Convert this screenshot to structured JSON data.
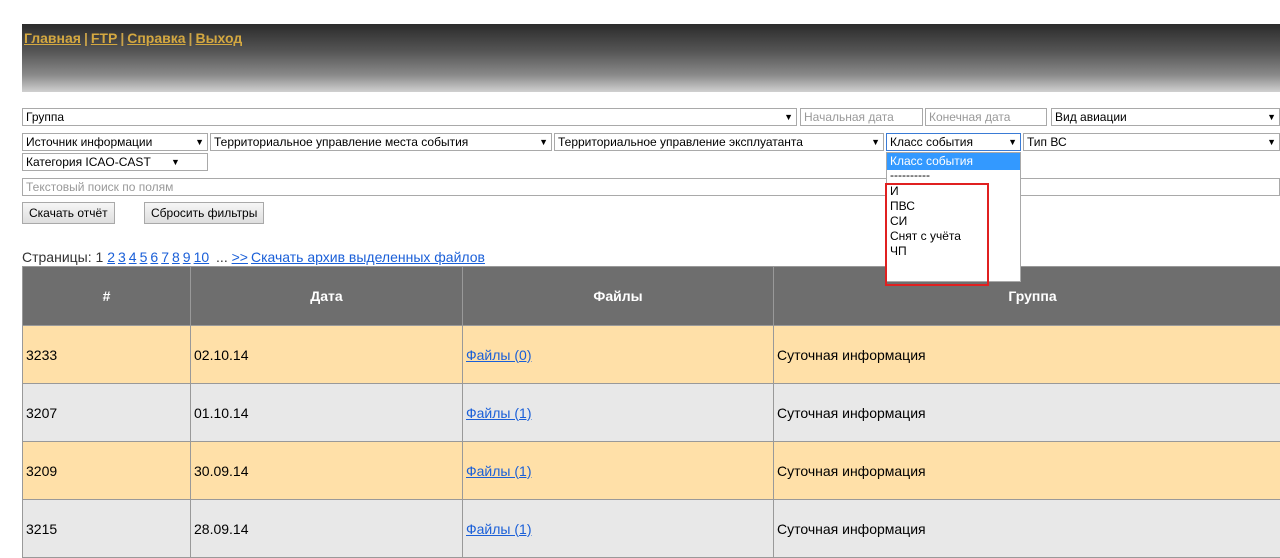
{
  "nav": {
    "home": "Главная",
    "ftp": "FTP",
    "help": "Справка",
    "logout": "Выход",
    "separator": "|"
  },
  "filters": {
    "group": "Группа",
    "start_date_placeholder": "Начальная дата",
    "end_date_placeholder": "Конечная дата",
    "aviation_type": "Вид авиации",
    "info_source": "Источник информации",
    "territorial_event": "Территориальное управление места события",
    "territorial_operator": "Территориальное управление эксплуатанта",
    "event_class": "Класс события",
    "aircraft_type": "Тип ВС",
    "icao_category": "Категория ICAO-CAST",
    "text_search_placeholder": "Текстовый поиск по полям",
    "arrow": "▼"
  },
  "buttons": {
    "download_report": "Скачать отчёт",
    "reset_filters": "Сбросить фильтры"
  },
  "dropdown": {
    "selected": "Класс события",
    "divider": "----------",
    "options": [
      "И",
      "ПВС",
      "СИ",
      "Снят с учёта",
      "ЧП"
    ]
  },
  "pagination": {
    "label": "Страницы:",
    "current": "1",
    "pages": [
      "2",
      "3",
      "4",
      "5",
      "6",
      "7",
      "8",
      "9",
      "10"
    ],
    "ellipsis": "...",
    "next": ">>",
    "archive_link": "Скачать архив выделенных файлов"
  },
  "table": {
    "headers": [
      "#",
      "Дата",
      "Файлы",
      "Группа"
    ],
    "rows": [
      {
        "id": "3233",
        "date": "02.10.14",
        "files": "Файлы (0)",
        "group": "Суточная информация"
      },
      {
        "id": "3207",
        "date": "01.10.14",
        "files": "Файлы (1)",
        "group": "Суточная информация"
      },
      {
        "id": "3209",
        "date": "30.09.14",
        "files": "Файлы (1)",
        "group": "Суточная информация"
      },
      {
        "id": "3215",
        "date": "28.09.14",
        "files": "Файлы (1)",
        "group": "Суточная информация"
      }
    ]
  }
}
